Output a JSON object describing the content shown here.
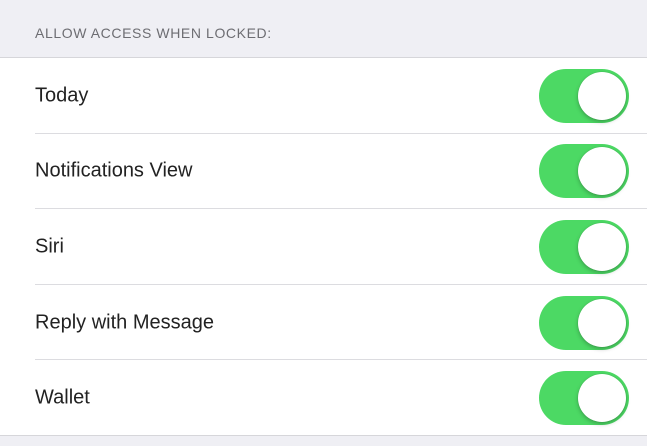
{
  "section": {
    "header": "ALLOW ACCESS WHEN LOCKED:"
  },
  "colors": {
    "toggle_on": "#4cd964",
    "background": "#efeff4"
  },
  "rows": [
    {
      "label": "Today",
      "toggle": "on"
    },
    {
      "label": "Notifications View",
      "toggle": "on"
    },
    {
      "label": "Siri",
      "toggle": "on"
    },
    {
      "label": "Reply with Message",
      "toggle": "on"
    },
    {
      "label": "Wallet",
      "toggle": "on"
    }
  ]
}
